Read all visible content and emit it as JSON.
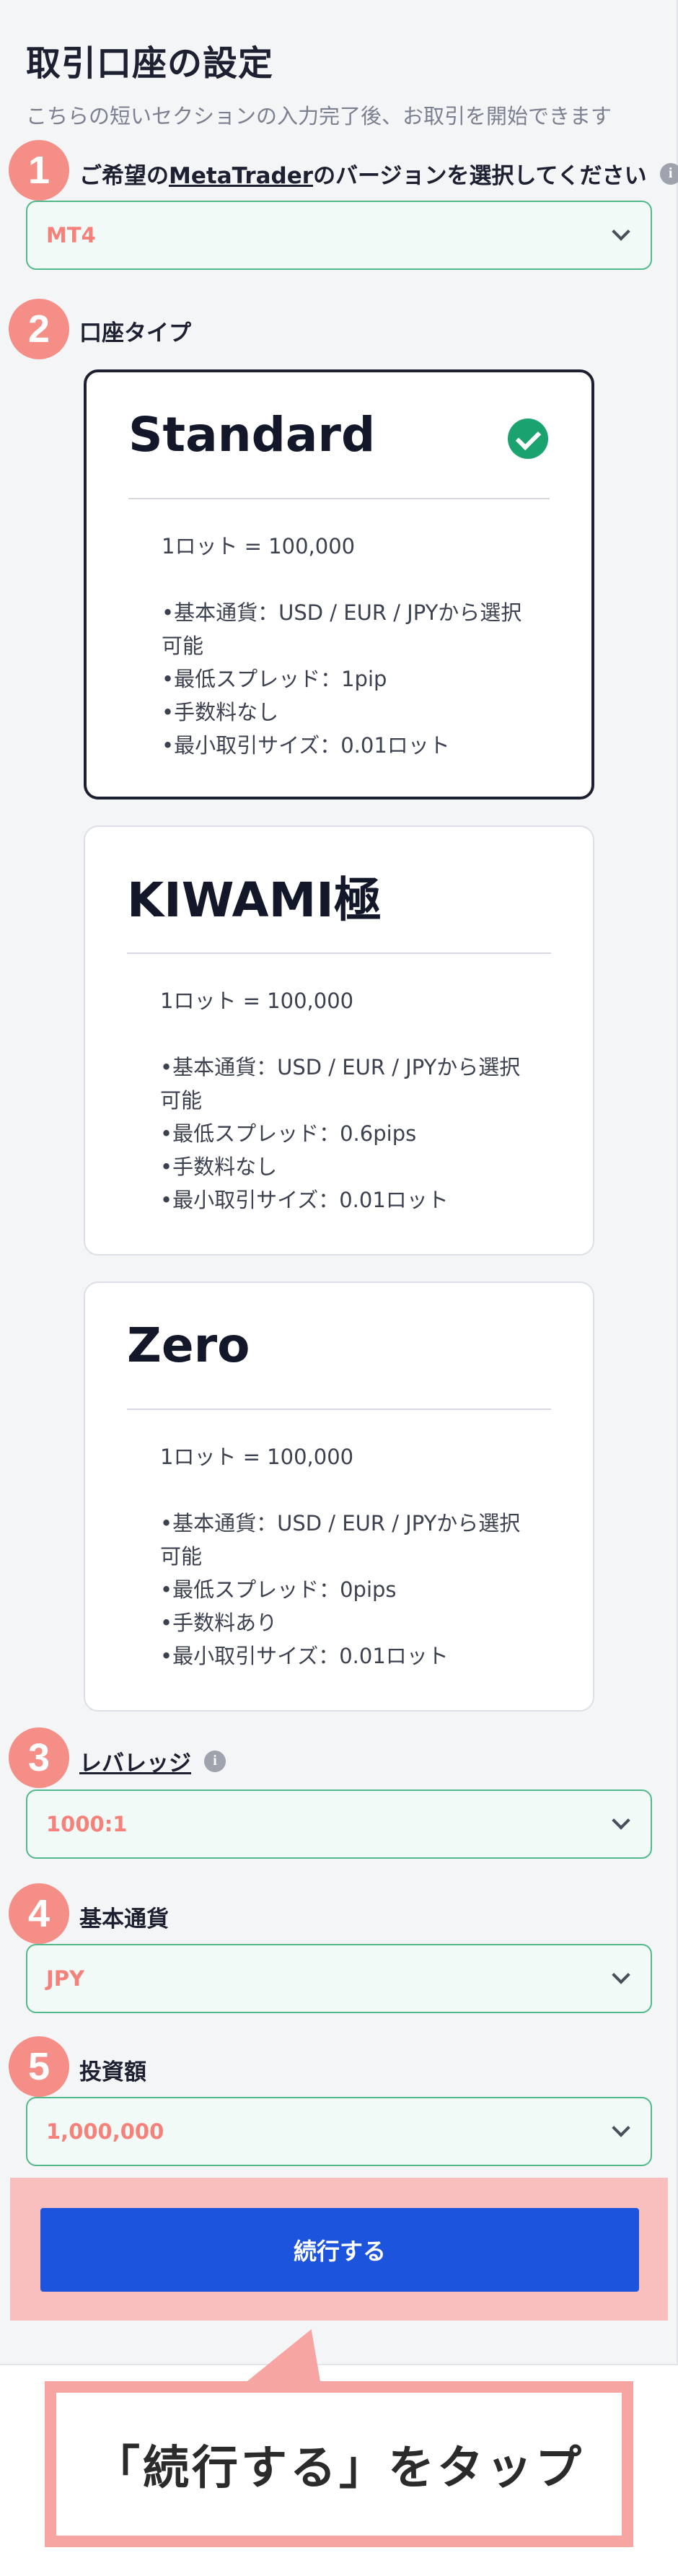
{
  "page": {
    "title": "取引口座の設定",
    "subtitle": "こちらの短いセクションの入力完了後、お取引を開始できます"
  },
  "steps": {
    "platform": {
      "number": "1",
      "label_prefix": "ご希望の",
      "label_link": "MetaTrader",
      "label_suffix": "のバージョンを選択してください",
      "value": "MT4"
    },
    "account_type": {
      "number": "2",
      "label": "口座タイプ"
    },
    "leverage": {
      "number": "3",
      "label": "レバレッジ",
      "value": "1000:1"
    },
    "base_currency": {
      "number": "4",
      "label": "基本通貨",
      "value": "JPY"
    },
    "investment": {
      "number": "5",
      "label": "投資額",
      "value": "1,000,000"
    }
  },
  "account_cards": [
    {
      "name": "Standard",
      "selected": true,
      "lot": "1ロット = 100,000",
      "features": [
        "•基本通貨：USD / EUR / JPYから選択",
        "可能",
        "•最低スプレッド：1pip",
        "•手数料なし",
        "•最小取引サイズ：0.01ロット"
      ]
    },
    {
      "name": "KIWAMI極",
      "selected": false,
      "lot": "1ロット = 100,000",
      "features": [
        "•基本通貨：USD / EUR / JPYから選択",
        "可能",
        "•最低スプレッド：0.6pips",
        "•手数料なし",
        "•最小取引サイズ：0.01ロット"
      ]
    },
    {
      "name": "Zero",
      "selected": false,
      "lot": "1ロット = 100,000",
      "features": [
        "•基本通貨：USD / EUR / JPYから選択",
        "可能",
        "•最低スプレッド：0pips",
        "•手数料あり",
        "•最小取引サイズ：0.01ロット"
      ]
    }
  ],
  "cta": {
    "label": "続行する"
  },
  "callout": {
    "text": "「続行する」をタップ"
  },
  "colors": {
    "accent_button": "#1d54de",
    "step_badge": "#f58e87",
    "select_value": "#f5817a",
    "select_border": "#52b98a",
    "check": "#1aa36f"
  },
  "icons": {
    "info": "info-icon",
    "dropdown": "chevron-down-icon",
    "selected": "check-circle-icon"
  }
}
